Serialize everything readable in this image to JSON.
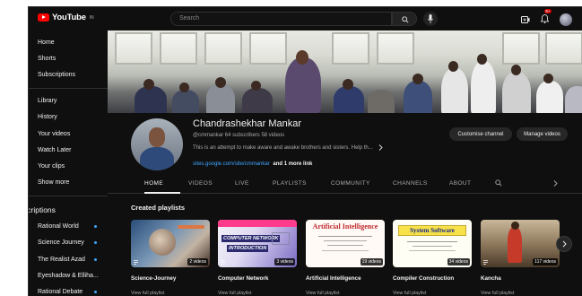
{
  "header": {
    "logo_text": "YouTube",
    "logo_sup": "IN",
    "search_placeholder": "Search",
    "notification_count": "9+"
  },
  "sidebar": {
    "main_items": [
      {
        "label": "Home"
      },
      {
        "label": "Shorts"
      },
      {
        "label": "Subscriptions"
      }
    ],
    "library_items": [
      {
        "label": "Library"
      },
      {
        "label": "History"
      },
      {
        "label": "Your videos"
      },
      {
        "label": "Watch Later"
      },
      {
        "label": "Your clips"
      },
      {
        "label": "Show more"
      }
    ],
    "subscriptions_heading": "scriptions",
    "subscriptions": [
      {
        "label": "Rational World"
      },
      {
        "label": "Science Journey"
      },
      {
        "label": "The Realist Azad"
      },
      {
        "label": "Eyeshadow & Elliha..."
      },
      {
        "label": "Rational Debate"
      }
    ]
  },
  "channel": {
    "name": "Chandrashekhar Mankar",
    "meta": "@cmmankar   64 subscribers   58 videos",
    "description": "This is an attempt to make aware and awake brothers and sisters. Help th...",
    "link": "sites.google.com/site/cmmankar",
    "more_links": "and 1 more link",
    "customise_label": "Customise channel",
    "manage_label": "Manage videos"
  },
  "tabs": [
    "HOME",
    "VIDEOS",
    "LIVE",
    "PLAYLISTS",
    "COMMUNITY",
    "CHANNELS",
    "ABOUT"
  ],
  "section_title": "Created playlists",
  "playlists": [
    {
      "title": "Science-Journey",
      "count": "2 videos",
      "link": "View full playlist"
    },
    {
      "title": "Computer Network",
      "count": "3 videos",
      "link": "View full playlist",
      "thumb_line1": "COMPUTER NETWORK",
      "thumb_line2": "INTRODUCTION"
    },
    {
      "title": "Artificial Intelligence",
      "count": "19 videos",
      "link": "View full playlist",
      "thumb_heading": "Artificial Intelligence"
    },
    {
      "title": "Compiler Construction",
      "count": "34 videos",
      "link": "View full playlist",
      "thumb_heading": "System Software"
    },
    {
      "title": "Kancha",
      "count": "117 videos",
      "link": "View full playlist"
    }
  ],
  "colors": {
    "background": "#0f0f0f",
    "accent_red": "#ff0000",
    "link_blue": "#3ea6ff"
  }
}
